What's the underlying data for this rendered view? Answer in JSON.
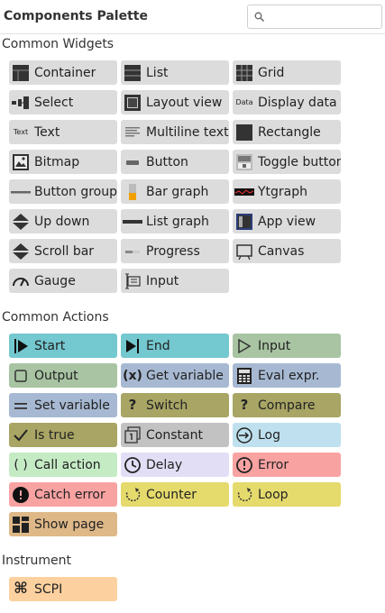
{
  "header": {
    "title": "Components Palette",
    "search_placeholder": ""
  },
  "sections": [
    {
      "title": "Common Widgets",
      "items": [
        {
          "label": "Container",
          "icon": "container-icon",
          "bg": "#dcdcdc"
        },
        {
          "label": "List",
          "icon": "list-icon",
          "bg": "#dcdcdc"
        },
        {
          "label": "Grid",
          "icon": "grid-icon",
          "bg": "#dcdcdc"
        },
        {
          "label": "Select",
          "icon": "select-icon",
          "bg": "#dcdcdc"
        },
        {
          "label": "Layout view",
          "icon": "layout-view-icon",
          "bg": "#dcdcdc"
        },
        {
          "label": "Display data",
          "icon": "display-data-icon",
          "bg": "#dcdcdc",
          "icon_text": "Data"
        },
        {
          "label": "Text",
          "icon": "text-icon",
          "bg": "#dcdcdc",
          "icon_text": "Text"
        },
        {
          "label": "Multiline text",
          "icon": "multiline-text-icon",
          "bg": "#dcdcdc"
        },
        {
          "label": "Rectangle",
          "icon": "rectangle-icon",
          "bg": "#dcdcdc"
        },
        {
          "label": "Bitmap",
          "icon": "bitmap-icon",
          "bg": "#dcdcdc"
        },
        {
          "label": "Button",
          "icon": "button-icon",
          "bg": "#dcdcdc"
        },
        {
          "label": "Toggle button",
          "icon": "toggle-button-icon",
          "bg": "#dcdcdc"
        },
        {
          "label": "Button group",
          "icon": "button-group-icon",
          "bg": "#dcdcdc"
        },
        {
          "label": "Bar graph",
          "icon": "bar-graph-icon",
          "bg": "#dcdcdc"
        },
        {
          "label": "Ytgraph",
          "icon": "ytgraph-icon",
          "bg": "#dcdcdc"
        },
        {
          "label": "Up down",
          "icon": "up-down-icon",
          "bg": "#dcdcdc"
        },
        {
          "label": "List graph",
          "icon": "list-graph-icon",
          "bg": "#dcdcdc"
        },
        {
          "label": "App view",
          "icon": "app-view-icon",
          "bg": "#dcdcdc"
        },
        {
          "label": "Scroll bar",
          "icon": "scroll-bar-icon",
          "bg": "#dcdcdc"
        },
        {
          "label": "Progress",
          "icon": "progress-icon",
          "bg": "#dcdcdc"
        },
        {
          "label": "Canvas",
          "icon": "canvas-icon",
          "bg": "#dcdcdc"
        },
        {
          "label": "Gauge",
          "icon": "gauge-icon",
          "bg": "#dcdcdc"
        },
        {
          "label": "Input",
          "icon": "input-icon",
          "bg": "#dcdcdc"
        }
      ]
    },
    {
      "title": "Common Actions",
      "items": [
        {
          "label": "Start",
          "icon": "start-icon",
          "bg": "#74c8cf"
        },
        {
          "label": "End",
          "icon": "end-icon",
          "bg": "#74c8cf"
        },
        {
          "label": "Input",
          "icon": "action-input-icon",
          "bg": "#a8c4a2"
        },
        {
          "label": "Output",
          "icon": "output-icon",
          "bg": "#a8c4a2"
        },
        {
          "label": "Get variable",
          "icon": "get-variable-icon",
          "bg": "#a7b9d2"
        },
        {
          "label": "Eval expr.",
          "icon": "eval-expr-icon",
          "bg": "#a7b9d2"
        },
        {
          "label": "Set variable",
          "icon": "set-variable-icon",
          "bg": "#a7b9d2"
        },
        {
          "label": "Switch",
          "icon": "switch-icon",
          "bg": "#a8a565"
        },
        {
          "label": "Compare",
          "icon": "compare-icon",
          "bg": "#a8a565"
        },
        {
          "label": "Is true",
          "icon": "is-true-icon",
          "bg": "#a8a565"
        },
        {
          "label": "Constant",
          "icon": "constant-icon",
          "bg": "#c2c2c2"
        },
        {
          "label": "Log",
          "icon": "log-icon",
          "bg": "#bfe0ee"
        },
        {
          "label": "Call action",
          "icon": "call-action-icon",
          "bg": "#c5ebc5"
        },
        {
          "label": "Delay",
          "icon": "delay-icon",
          "bg": "#e2def6"
        },
        {
          "label": "Error",
          "icon": "error-icon",
          "bg": "#f9a2a2"
        },
        {
          "label": "Catch error",
          "icon": "catch-error-icon",
          "bg": "#f9a2a2"
        },
        {
          "label": "Counter",
          "icon": "counter-icon",
          "bg": "#e5da6c"
        },
        {
          "label": "Loop",
          "icon": "loop-icon",
          "bg": "#e5da6c"
        },
        {
          "label": "Show page",
          "icon": "show-page-icon",
          "bg": "#dfb888"
        }
      ]
    },
    {
      "title": "Instrument",
      "items": [
        {
          "label": "SCPI",
          "icon": "scpi-icon",
          "bg": "#fdd19f"
        }
      ]
    }
  ]
}
